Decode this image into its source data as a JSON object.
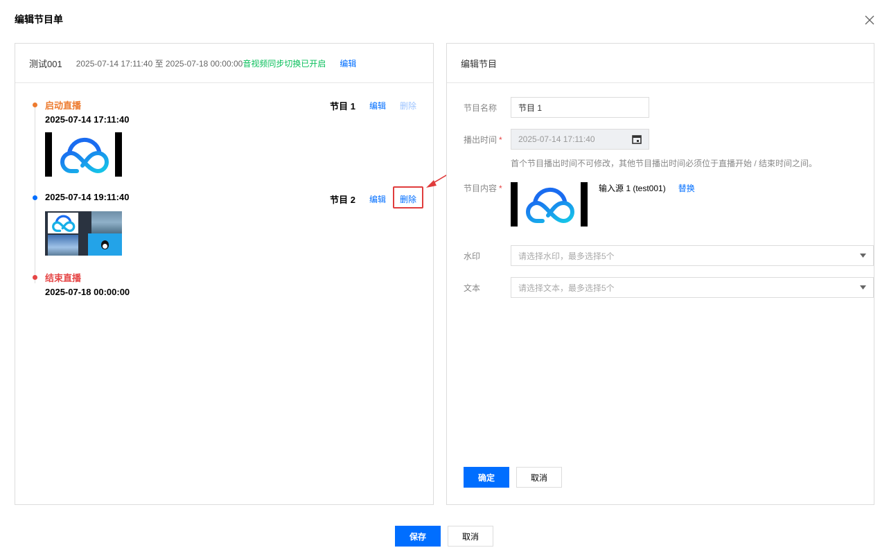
{
  "dialog": {
    "title": "编辑节目单"
  },
  "left": {
    "list_name": "测试001",
    "time_range": "2025-07-14 17:11:40 至 2025-07-18 00:00:00",
    "sync_status": "音视频同步切换已开启",
    "edit_label": "编辑"
  },
  "timeline": {
    "start": {
      "label": "启动直播",
      "time": "2025-07-14 17:11:40",
      "program": "节目 1",
      "edit": "编辑",
      "delete": "删除"
    },
    "program2": {
      "time": "2025-07-14 19:11:40",
      "program": "节目 2",
      "edit": "编辑",
      "delete": "删除"
    },
    "end": {
      "label": "结束直播",
      "time": "2025-07-18 00:00:00"
    }
  },
  "right": {
    "title": "编辑节目",
    "name_label": "节目名称",
    "name_value": "节目 1",
    "time_label": "播出时间",
    "time_value": "2025-07-14 17:11:40",
    "tip": "首个节目播出时间不可修改，其他节目播出时间必须位于直播开始 / 结束时间之间。",
    "content_label": "节目内容",
    "source_name": "输入源 1 (test001)",
    "replace_label": "替换",
    "watermark_label": "水印",
    "watermark_placeholder": "请选择水印，最多选择5个",
    "text_label": "文本",
    "text_placeholder": "请选择文本，最多选择5个",
    "confirm": "确定",
    "cancel": "取消"
  },
  "footer": {
    "save": "保存",
    "cancel": "取消"
  },
  "colors": {
    "accent": "#006eff",
    "start": "#ed7b2f",
    "end": "#e54545",
    "success": "#0abf5b",
    "annotation": "#e03c3c"
  }
}
